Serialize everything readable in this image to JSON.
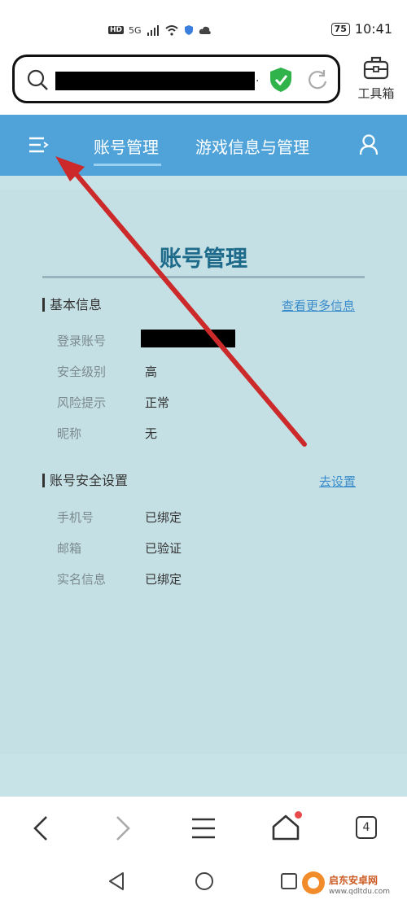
{
  "status_bar": {
    "hd": "HD",
    "network": "5G",
    "battery": "75",
    "time": "10:41"
  },
  "address_bar": {
    "url_suffix": "."
  },
  "toolbar": {
    "toolbox_label": "工具箱"
  },
  "web_nav": {
    "tab_active": "账号管理",
    "tab_2": "游戏信息与管理"
  },
  "page": {
    "title": "账号管理",
    "basic_info": {
      "heading": "基本信息",
      "link": "查看更多信息",
      "rows": [
        {
          "label": "登录账号",
          "value": ""
        },
        {
          "label": "安全级别",
          "value": "高"
        },
        {
          "label": "风险提示",
          "value": "正常"
        },
        {
          "label": "昵称",
          "value": "无"
        }
      ]
    },
    "security": {
      "heading": "账号安全设置",
      "link": "去设置",
      "rows": [
        {
          "label": "手机号",
          "value": "已绑定"
        },
        {
          "label": "邮箱",
          "value": "已验证"
        },
        {
          "label": "实名信息",
          "value": "已绑定"
        }
      ]
    }
  },
  "bottom_nav": {
    "tab_count": "4"
  },
  "watermark": {
    "name": "启东安卓网",
    "url": "www.qdltdu.com"
  },
  "colors": {
    "header": "#4fa3d9",
    "page_bg": "#c8e3e8",
    "title": "#1d6a8a",
    "link": "#3a8ccb",
    "arrow": "#cc2a2a"
  }
}
